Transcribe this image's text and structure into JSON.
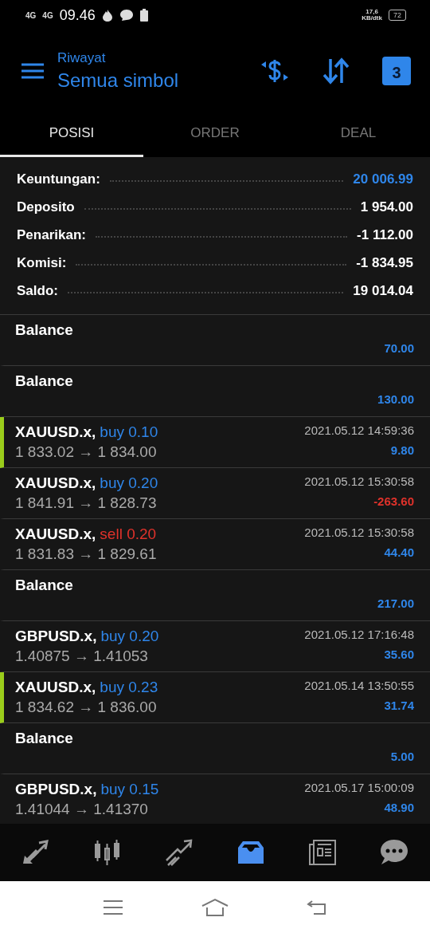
{
  "status_bar": {
    "network_1": "4G",
    "network_2": "4G",
    "time": "09.46",
    "speed": "17,6",
    "speed_unit": "KB/dtk",
    "battery": "72"
  },
  "header": {
    "subtitle": "Riwayat",
    "title": "Semua simbol",
    "calendar_day": "3"
  },
  "tabs": [
    {
      "label": "POSISI",
      "selected": true
    },
    {
      "label": "ORDER",
      "selected": false
    },
    {
      "label": "DEAL",
      "selected": false
    }
  ],
  "summary": [
    {
      "label": "Keuntungan:",
      "value": "20 006.99",
      "highlight": true
    },
    {
      "label": "Deposito",
      "value": "1 954.00",
      "highlight": false
    },
    {
      "label": "Penarikan:",
      "value": "-1 112.00",
      "highlight": false
    },
    {
      "label": "Komisi:",
      "value": "-1 834.95",
      "highlight": false
    },
    {
      "label": "Saldo:",
      "value": "19 014.04",
      "highlight": false
    }
  ],
  "rows": [
    {
      "kind": "balance",
      "title": "Balance",
      "amount": "70.00",
      "negative": false
    },
    {
      "kind": "balance",
      "title": "Balance",
      "amount": "130.00",
      "negative": false
    },
    {
      "kind": "deal",
      "symbol": "XAUUSD.x,",
      "sell": false,
      "trade": "buy 0.10",
      "prices": "1 833.02 → 1 834.00",
      "time": "2021.05.12 14:59:36",
      "amount": "9.80",
      "negative": false,
      "marked": true
    },
    {
      "kind": "deal",
      "symbol": "XAUUSD.x,",
      "sell": false,
      "trade": "buy 0.20",
      "prices": "1 841.91 → 1 828.73",
      "time": "2021.05.12 15:30:58",
      "amount": "-263.60",
      "negative": true,
      "marked": false
    },
    {
      "kind": "deal",
      "symbol": "XAUUSD.x,",
      "sell": true,
      "trade": "sell 0.20",
      "prices": "1 831.83 → 1 829.61",
      "time": "2021.05.12 15:30:58",
      "amount": "44.40",
      "negative": false,
      "marked": false
    },
    {
      "kind": "balance",
      "title": "Balance",
      "amount": "217.00",
      "negative": false
    },
    {
      "kind": "deal",
      "symbol": "GBPUSD.x,",
      "sell": false,
      "trade": "buy 0.20",
      "prices": "1.40875 → 1.41053",
      "time": "2021.05.12 17:16:48",
      "amount": "35.60",
      "negative": false,
      "marked": false
    },
    {
      "kind": "deal",
      "symbol": "XAUUSD.x,",
      "sell": false,
      "trade": "buy 0.23",
      "prices": "1 834.62 → 1 836.00",
      "time": "2021.05.14 13:50:55",
      "amount": "31.74",
      "negative": false,
      "marked": true
    },
    {
      "kind": "balance",
      "title": "Balance",
      "amount": "5.00",
      "negative": false
    },
    {
      "kind": "deal",
      "symbol": "GBPUSD.x,",
      "sell": false,
      "trade": "buy 0.15",
      "prices": "1.41044 → 1.41370",
      "time": "2021.05.17 15:00:09",
      "amount": "48.90",
      "negative": false,
      "marked": false
    }
  ],
  "bottom_nav": [
    {
      "kind": "quotes",
      "selected": false
    },
    {
      "kind": "chart",
      "selected": false
    },
    {
      "kind": "trade",
      "selected": false
    },
    {
      "kind": "history",
      "selected": true
    },
    {
      "kind": "news",
      "selected": false
    },
    {
      "kind": "chat",
      "selected": false
    }
  ]
}
